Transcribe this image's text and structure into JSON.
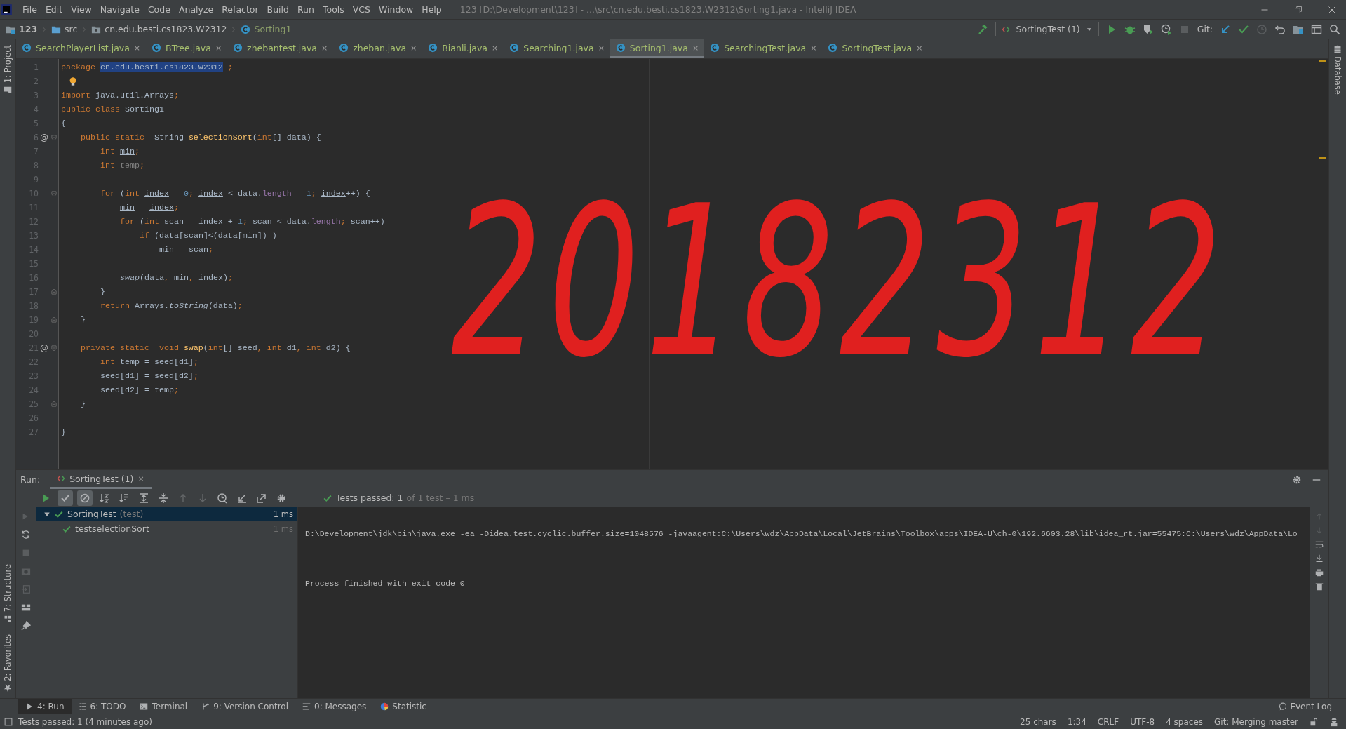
{
  "window": {
    "title": "123 [D:\\Development\\123] - ...\\src\\cn.edu.besti.cs1823.W2312\\Sorting1.java - IntelliJ IDEA"
  },
  "menu": [
    "File",
    "Edit",
    "View",
    "Navigate",
    "Code",
    "Analyze",
    "Refactor",
    "Build",
    "Run",
    "Tools",
    "VCS",
    "Window",
    "Help"
  ],
  "breadcrumbs": [
    {
      "label": "123",
      "kind": "project"
    },
    {
      "label": "src",
      "kind": "folder"
    },
    {
      "label": "cn.edu.besti.cs1823.W2312",
      "kind": "package"
    },
    {
      "label": "Sorting1",
      "kind": "class"
    }
  ],
  "toolbar": {
    "run_config": "SortingTest (1)",
    "vcs_label": "Git:"
  },
  "left_strip": {
    "top": [
      "1: Project"
    ],
    "bottom": [
      "7: Structure",
      "2: Favorites"
    ]
  },
  "right_strip": [
    "Database"
  ],
  "tabs": [
    {
      "label": "SearchPlayerList.java",
      "close": "×",
      "selected": false
    },
    {
      "label": "BTree.java",
      "close": "×",
      "selected": false
    },
    {
      "label": "zhebantest.java",
      "close": "×",
      "selected": false
    },
    {
      "label": "zheban.java",
      "close": "×",
      "selected": false
    },
    {
      "label": "Bianli.java",
      "close": "×",
      "selected": false
    },
    {
      "label": "Searching1.java",
      "close": "×",
      "selected": false
    },
    {
      "label": "Sorting1.java",
      "close": "×",
      "selected": true
    },
    {
      "label": "SearchingTest.java",
      "close": "×",
      "selected": false
    },
    {
      "label": "SortingTest.java",
      "close": "×",
      "selected": false
    }
  ],
  "editor": {
    "lines": [
      {
        "number": "1",
        "code": [
          {
            "text": "package ",
            "kind": "kw"
          },
          {
            "text": "cn.edu.besti.cs1823.W2312",
            "kind": "sel"
          },
          {
            "text": " ;",
            "kind": "kw"
          }
        ]
      },
      {
        "number": "2",
        "hint": {
          "kind": "bulb"
        }
      },
      {
        "number": "3",
        "code": [
          {
            "text": "import ",
            "kind": "kw"
          },
          {
            "text": "java.util.Arrays",
            "kind": "plain"
          },
          {
            "text": ";",
            "kind": "kw"
          }
        ]
      },
      {
        "number": "4",
        "code": [
          {
            "text": "public class ",
            "kind": "kw"
          },
          {
            "text": "Sorting1",
            "kind": "plain"
          }
        ]
      },
      {
        "number": "5",
        "code": [
          {
            "text": "{",
            "kind": "plain"
          }
        ]
      },
      {
        "number": "6",
        "mark": "@",
        "fold": {
          "kind": "start"
        },
        "code": [
          {
            "text": "    public static  ",
            "kind": "kw"
          },
          {
            "text": "String ",
            "kind": "plain"
          },
          {
            "text": "selectionSort",
            "kind": "decl"
          },
          {
            "text": "(",
            "kind": "plain"
          },
          {
            "text": "int",
            "kind": "kw"
          },
          {
            "text": "[] data) {",
            "kind": "plain"
          }
        ]
      },
      {
        "number": "7",
        "code": [
          {
            "text": "        int ",
            "kind": "kw"
          },
          {
            "text": "min",
            "kind": "var"
          },
          {
            "text": ";",
            "kind": "kw"
          }
        ]
      },
      {
        "number": "8",
        "code": [
          {
            "text": "        int ",
            "kind": "kw"
          },
          {
            "text": "temp",
            "kind": "unused"
          },
          {
            "text": ";",
            "kind": "kw"
          }
        ]
      },
      {
        "number": "9"
      },
      {
        "number": "10",
        "fold": {
          "kind": "start"
        },
        "code": [
          {
            "text": "        for ",
            "kind": "kw"
          },
          {
            "text": "(",
            "kind": "plain"
          },
          {
            "text": "int ",
            "kind": "kw"
          },
          {
            "text": "index",
            "kind": "var"
          },
          {
            "text": " = ",
            "kind": "plain"
          },
          {
            "text": "0",
            "kind": "num"
          },
          {
            "text": "; ",
            "kind": "kw"
          },
          {
            "text": "index",
            "kind": "var"
          },
          {
            "text": " < data.",
            "kind": "plain"
          },
          {
            "text": "length",
            "kind": "field"
          },
          {
            "text": " - ",
            "kind": "plain"
          },
          {
            "text": "1",
            "kind": "num"
          },
          {
            "text": "; ",
            "kind": "kw"
          },
          {
            "text": "index",
            "kind": "var"
          },
          {
            "text": "++) {",
            "kind": "plain"
          }
        ]
      },
      {
        "number": "11",
        "code": [
          {
            "text": "            min",
            "kind": "var"
          },
          {
            "text": " = ",
            "kind": "plain"
          },
          {
            "text": "index",
            "kind": "var"
          },
          {
            "text": ";",
            "kind": "kw"
          }
        ]
      },
      {
        "number": "12",
        "code": [
          {
            "text": "            for ",
            "kind": "kw"
          },
          {
            "text": "(",
            "kind": "plain"
          },
          {
            "text": "int ",
            "kind": "kw"
          },
          {
            "text": "scan",
            "kind": "var"
          },
          {
            "text": " = ",
            "kind": "plain"
          },
          {
            "text": "index",
            "kind": "var"
          },
          {
            "text": " + ",
            "kind": "plain"
          },
          {
            "text": "1",
            "kind": "num"
          },
          {
            "text": "; ",
            "kind": "kw"
          },
          {
            "text": "scan",
            "kind": "var"
          },
          {
            "text": " < data.",
            "kind": "plain"
          },
          {
            "text": "length",
            "kind": "field"
          },
          {
            "text": "; ",
            "kind": "kw"
          },
          {
            "text": "scan",
            "kind": "var"
          },
          {
            "text": "++)",
            "kind": "plain"
          }
        ]
      },
      {
        "number": "13",
        "code": [
          {
            "text": "                if ",
            "kind": "kw"
          },
          {
            "text": "(data[",
            "kind": "plain"
          },
          {
            "text": "scan",
            "kind": "var"
          },
          {
            "text": "]<(data[",
            "kind": "plain"
          },
          {
            "text": "min",
            "kind": "var"
          },
          {
            "text": "]) )",
            "kind": "plain"
          }
        ]
      },
      {
        "number": "14",
        "code": [
          {
            "text": "                    min",
            "kind": "var"
          },
          {
            "text": " = ",
            "kind": "plain"
          },
          {
            "text": "scan",
            "kind": "var"
          },
          {
            "text": ";",
            "kind": "kw"
          }
        ]
      },
      {
        "number": "15"
      },
      {
        "number": "16",
        "code": [
          {
            "text": "            swap",
            "kind": "call"
          },
          {
            "text": "(data",
            "kind": "plain"
          },
          {
            "text": ", ",
            "kind": "kw"
          },
          {
            "text": "min",
            "kind": "var"
          },
          {
            "text": ", ",
            "kind": "kw"
          },
          {
            "text": "index",
            "kind": "var"
          },
          {
            "text": ")",
            "kind": "plain"
          },
          {
            "text": ";",
            "kind": "kw"
          }
        ]
      },
      {
        "number": "17",
        "fold": {
          "kind": "end"
        },
        "code": [
          {
            "text": "        }",
            "kind": "plain"
          }
        ]
      },
      {
        "number": "18",
        "code": [
          {
            "text": "        return ",
            "kind": "kw"
          },
          {
            "text": "Arrays.",
            "kind": "plain"
          },
          {
            "text": "toString",
            "kind": "call"
          },
          {
            "text": "(data)",
            "kind": "plain"
          },
          {
            "text": ";",
            "kind": "kw"
          }
        ]
      },
      {
        "number": "19",
        "fold": {
          "kind": "end"
        },
        "code": [
          {
            "text": "    }",
            "kind": "plain"
          }
        ]
      },
      {
        "number": "20"
      },
      {
        "number": "21",
        "mark": "@",
        "fold": {
          "kind": "start"
        },
        "code": [
          {
            "text": "    private static  void ",
            "kind": "kw"
          },
          {
            "text": "swap",
            "kind": "decl"
          },
          {
            "text": "(",
            "kind": "plain"
          },
          {
            "text": "int",
            "kind": "kw"
          },
          {
            "text": "[] seed",
            "kind": "plain"
          },
          {
            "text": ", ",
            "kind": "kw"
          },
          {
            "text": "int ",
            "kind": "kw"
          },
          {
            "text": "d1",
            "kind": "plain"
          },
          {
            "text": ", ",
            "kind": "kw"
          },
          {
            "text": "int ",
            "kind": "kw"
          },
          {
            "text": "d2) {",
            "kind": "plain"
          }
        ]
      },
      {
        "number": "22",
        "code": [
          {
            "text": "        int ",
            "kind": "kw"
          },
          {
            "text": "temp = seed[d1]",
            "kind": "plain"
          },
          {
            "text": ";",
            "kind": "kw"
          }
        ]
      },
      {
        "number": "23",
        "code": [
          {
            "text": "        seed[d1] = seed[d2]",
            "kind": "plain"
          },
          {
            "text": ";",
            "kind": "kw"
          }
        ]
      },
      {
        "number": "24",
        "code": [
          {
            "text": "        seed[d2] = temp",
            "kind": "plain"
          },
          {
            "text": ";",
            "kind": "kw"
          }
        ]
      },
      {
        "number": "25",
        "fold": {
          "kind": "end"
        },
        "code": [
          {
            "text": "    }",
            "kind": "plain"
          }
        ]
      },
      {
        "number": "26"
      },
      {
        "number": "27",
        "code": [
          {
            "text": "}",
            "kind": "plain"
          }
        ]
      }
    ]
  },
  "annotation": {
    "text": "20182312"
  },
  "run": {
    "label": "Run:",
    "tab": "SortingTest (1)",
    "tab_close": "×",
    "status": "Tests passed: 1",
    "status_detail": "of 1 test – 1 ms",
    "toolbar": [
      {
        "kind": "rerun",
        "on": false,
        "disabled": false
      },
      {
        "kind": "passed",
        "on": true,
        "disabled": false
      },
      {
        "kind": "ignored",
        "on": true,
        "disabled": false
      },
      {
        "kind": "sort-alpha",
        "on": false,
        "disabled": false
      },
      {
        "kind": "sort-duration",
        "on": false,
        "disabled": false
      },
      {
        "kind": "expand",
        "on": false,
        "disabled": false
      },
      {
        "kind": "collapse",
        "on": false,
        "disabled": false
      },
      {
        "kind": "up",
        "on": false,
        "disabled": true
      },
      {
        "kind": "down",
        "on": false,
        "disabled": true
      },
      {
        "kind": "history",
        "on": false,
        "disabled": false
      },
      {
        "kind": "import",
        "on": false,
        "disabled": false
      },
      {
        "kind": "export",
        "on": false,
        "disabled": false
      },
      {
        "kind": "settings",
        "on": false,
        "disabled": false
      }
    ],
    "tree": [
      {
        "label": "SortingTest",
        "note": "(test)",
        "time": "1 ms",
        "selected": true,
        "expanded": true,
        "children": [
          {
            "label": "testselectionSort",
            "time": "1 ms",
            "selected": false
          }
        ]
      }
    ],
    "console": [
      {
        "kind": "command",
        "text": "D:\\Development\\jdk\\bin\\java.exe -ea -Didea.test.cyclic.buffer.size=1048576 -javaagent:C:\\Users\\wdz\\AppData\\Local\\JetBrains\\Toolbox\\apps\\IDEA-U\\ch-0\\192.6603.28\\lib\\idea_rt.jar=55475:C:\\Users\\wdz\\AppData\\Lo"
      },
      {
        "kind": "exit",
        "text": "Process finished with exit code 0"
      }
    ]
  },
  "tool_windows": [
    {
      "label": "4: Run",
      "kind": "run",
      "selected": true
    },
    {
      "label": "6: TODO",
      "kind": "todo",
      "selected": false
    },
    {
      "label": "Terminal",
      "kind": "terminal",
      "selected": false
    },
    {
      "label": "9: Version Control",
      "kind": "vcs",
      "selected": false
    },
    {
      "label": "0: Messages",
      "kind": "messages",
      "selected": false
    },
    {
      "label": "Statistic",
      "kind": "statistic",
      "selected": false
    }
  ],
  "event_log": "Event Log",
  "status_bar": {
    "message": "Tests passed: 1 (4 minutes ago)",
    "items": [
      "25 chars",
      "1:34",
      "CRLF",
      "UTF-8",
      "4 spaces",
      "Git: Merging master"
    ]
  }
}
